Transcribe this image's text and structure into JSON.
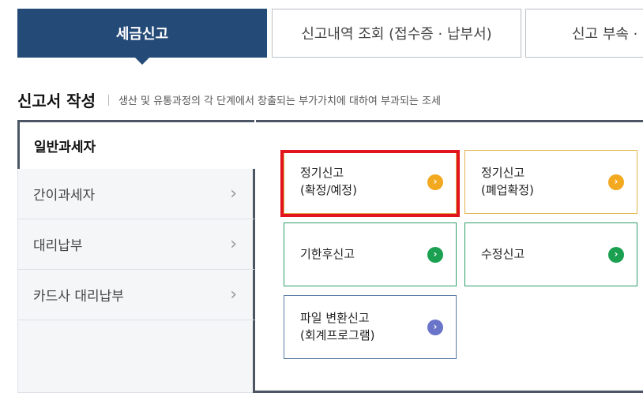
{
  "tabs": [
    {
      "label": "세금신고",
      "active": true
    },
    {
      "label": "신고내역 조회 (접수증 · 납부서)",
      "active": false
    },
    {
      "label": "신고 부속 ·",
      "active": false
    }
  ],
  "section": {
    "title": "신고서 작성",
    "description": "생산 및 유통과정의 각 단계에서 창출되는 부가가치에 대하여 부과되는 조세"
  },
  "sidebar": {
    "active": "일반과세자",
    "items": [
      {
        "label": "간이과세자"
      },
      {
        "label": "대리납부"
      },
      {
        "label": "카드사 대리납부"
      }
    ]
  },
  "cards": [
    {
      "label": "정기신고\n(확정/예정)",
      "color": "#f2a920",
      "highlighted": true
    },
    {
      "label": "정기신고\n(폐업확정)",
      "color": "#f2a920",
      "highlighted": false
    },
    {
      "label": "기한후신고",
      "color": "#1aa050",
      "highlighted": false
    },
    {
      "label": "수정신고",
      "color": "#1aa050",
      "highlighted": false
    },
    {
      "label": "파일 변환신고\n(회계프로그램)",
      "color": "#6a74c9",
      "highlighted": false
    }
  ],
  "icons": {
    "arrow": "chevron-right-icon"
  }
}
